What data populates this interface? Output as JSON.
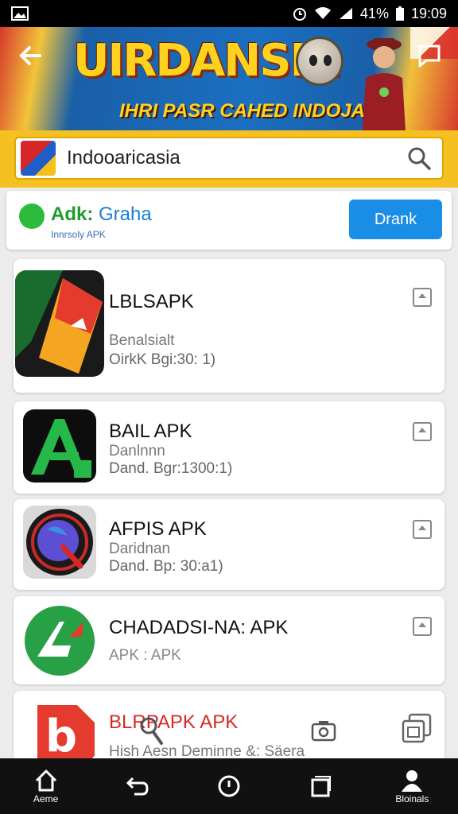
{
  "status": {
    "battery": "41%",
    "time": "19:09"
  },
  "banner": {
    "title": "UIRDANSIA",
    "subtitle": "IHRI PASR CAHED INDOJAN"
  },
  "search": {
    "value": "Indooaricasia"
  },
  "ad": {
    "name": "Adk:",
    "name2": "Graha",
    "tagline": "Innrsoly APK",
    "button": "Drank"
  },
  "apps": [
    {
      "name": "LBLSAPK",
      "developer": "Benalsialt",
      "meta": "OirkK Bgi:30: 1)"
    },
    {
      "name": "BAIL APK",
      "developer": "Danlnnn",
      "meta": "Dand. Bgr:1300:1)"
    },
    {
      "name": "AFPIS APK",
      "developer": "Daridnan",
      "meta": "Dand. Bp: 30:a1)"
    },
    {
      "name": "CHADADSI-NA: APK",
      "developer": "",
      "meta": "APK : APK"
    },
    {
      "name": "BLRPAPK APK",
      "developer": "",
      "meta": "Hish Aesn Deminne &: Säera"
    }
  ],
  "nav": {
    "home": "Aeme",
    "profile": "Bloinals"
  },
  "colors": {
    "accent": "#1a8de6",
    "banner_yellow": "#ffd21f",
    "search_bar": "#f4c022"
  }
}
